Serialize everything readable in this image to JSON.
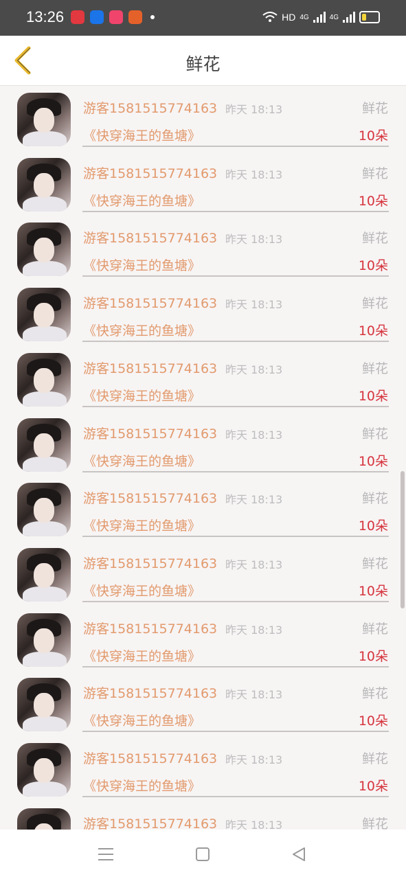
{
  "status_bar": {
    "time": "13:26",
    "network_label": "HD",
    "signal_1": "4G",
    "signal_2": "4G",
    "battery_level": 0.35,
    "icons": [
      "wifi-icon",
      "signal-icon",
      "battery-icon"
    ]
  },
  "header": {
    "title": "鲜花",
    "back_icon": "chevron-left-icon",
    "accent": "#e8b82e"
  },
  "colors": {
    "user": "#e29a6d",
    "amount": "#d6343d",
    "muted": "#b8b8b8"
  },
  "rows": [
    {
      "user": "游客1581515774163",
      "time": "昨天 18:13",
      "type": "鲜花",
      "book": "《快穿海王的鱼塘》",
      "amount": "10朵"
    },
    {
      "user": "游客1581515774163",
      "time": "昨天 18:13",
      "type": "鲜花",
      "book": "《快穿海王的鱼塘》",
      "amount": "10朵"
    },
    {
      "user": "游客1581515774163",
      "time": "昨天 18:13",
      "type": "鲜花",
      "book": "《快穿海王的鱼塘》",
      "amount": "10朵"
    },
    {
      "user": "游客1581515774163",
      "time": "昨天 18:13",
      "type": "鲜花",
      "book": "《快穿海王的鱼塘》",
      "amount": "10朵"
    },
    {
      "user": "游客1581515774163",
      "time": "昨天 18:13",
      "type": "鲜花",
      "book": "《快穿海王的鱼塘》",
      "amount": "10朵"
    },
    {
      "user": "游客1581515774163",
      "time": "昨天 18:13",
      "type": "鲜花",
      "book": "《快穿海王的鱼塘》",
      "amount": "10朵"
    },
    {
      "user": "游客1581515774163",
      "time": "昨天 18:13",
      "type": "鲜花",
      "book": "《快穿海王的鱼塘》",
      "amount": "10朵"
    },
    {
      "user": "游客1581515774163",
      "time": "昨天 18:13",
      "type": "鲜花",
      "book": "《快穿海王的鱼塘》",
      "amount": "10朵"
    },
    {
      "user": "游客1581515774163",
      "time": "昨天 18:13",
      "type": "鲜花",
      "book": "《快穿海王的鱼塘》",
      "amount": "10朵"
    },
    {
      "user": "游客1581515774163",
      "time": "昨天 18:13",
      "type": "鲜花",
      "book": "《快穿海王的鱼塘》",
      "amount": "10朵"
    },
    {
      "user": "游客1581515774163",
      "time": "昨天 18:13",
      "type": "鲜花",
      "book": "《快穿海王的鱼塘》",
      "amount": "10朵"
    },
    {
      "user": "游客1581515774163",
      "time": "昨天 18:13",
      "type": "鲜花",
      "book": "",
      "amount": ""
    }
  ],
  "nav_bar": {
    "icons": [
      "menu-icon",
      "home-icon",
      "back-triangle-icon"
    ]
  }
}
